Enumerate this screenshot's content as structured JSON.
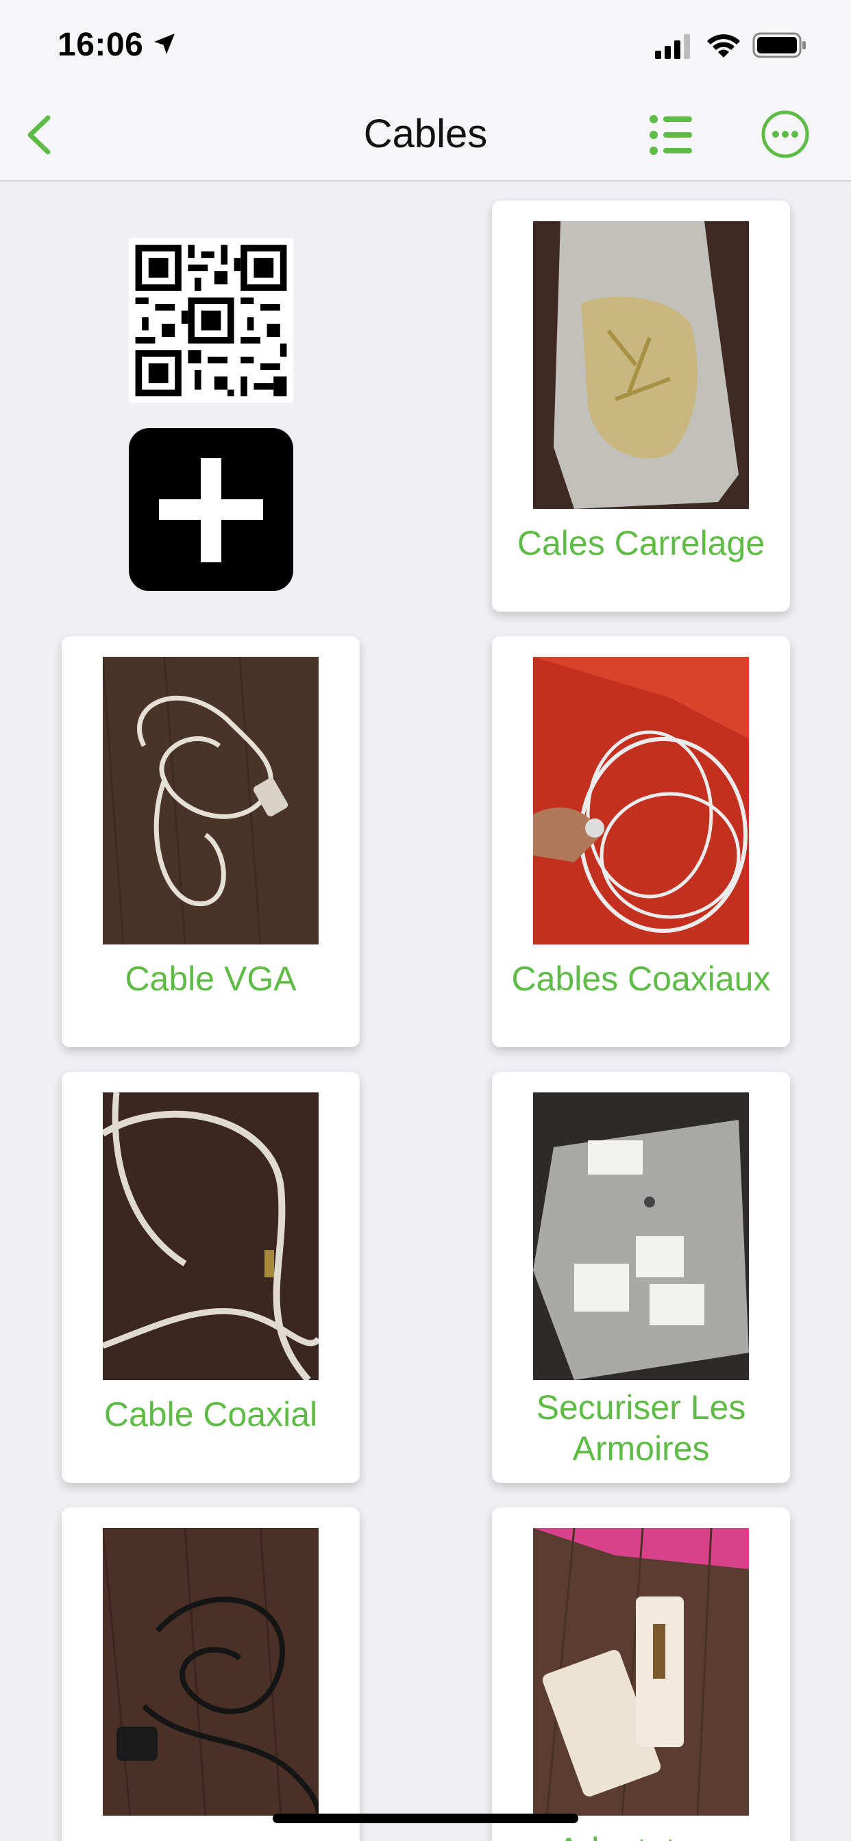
{
  "status": {
    "time": "16:06"
  },
  "nav": {
    "title": "Cables"
  },
  "items": [
    {
      "label": "Cales Carrelage"
    },
    {
      "label": "Cable VGA"
    },
    {
      "label": "Cables Coaxiaux"
    },
    {
      "label": "Cable Coaxial"
    },
    {
      "label": "Securiser Les Armoires"
    },
    {
      "label": ""
    },
    {
      "label": "Adaptateur"
    }
  ],
  "colors": {
    "accent": "#5dbb46",
    "background": "#efeff4"
  }
}
